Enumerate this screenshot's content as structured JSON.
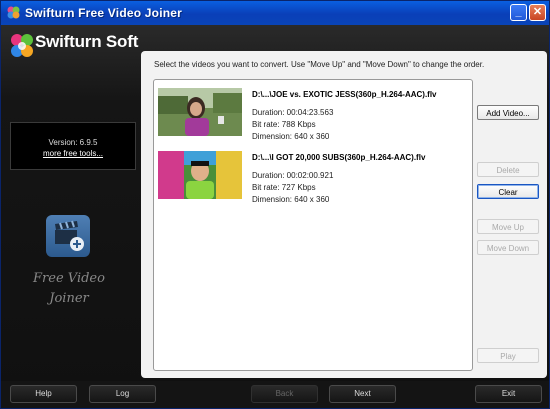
{
  "window": {
    "title": "Swifturn Free Video Joiner"
  },
  "sidebar": {
    "logo_text": "Swifturn Soft",
    "version": "Version: 6.9.5",
    "more_link": "more free tools...",
    "product_name_line1": "Free Video",
    "product_name_line2": "Joiner"
  },
  "main": {
    "instructions": "Select the videos you want to convert. Use \"Move Up\" and \"Move Down\" to change the order.",
    "videos": [
      {
        "file": "D:\\...\\JOE vs. EXOTIC JESS(360p_H.264-AAC).flv",
        "duration": "Duration: 00:04:23.563",
        "bitrate": "Bit rate: 788 Kbps",
        "dimension": "Dimension: 640 x 360"
      },
      {
        "file": "D:\\...\\I GOT 20,000 SUBS(360p_H.264-AAC).flv",
        "duration": "Duration: 00:02:00.921",
        "bitrate": "Bit rate: 727 Kbps",
        "dimension": "Dimension: 640 x 360"
      }
    ],
    "buttons": {
      "add_video": "Add Video...",
      "delete": "Delete",
      "clear": "Clear",
      "move_up": "Move Up",
      "move_down": "Move Down",
      "play": "Play"
    }
  },
  "bottom": {
    "help": "Help",
    "log": "Log",
    "back": "Back",
    "next": "Next",
    "exit": "Exit"
  },
  "colors": {
    "titlebar": "#0a4fd0",
    "accent_blue": "#1a56c2"
  }
}
